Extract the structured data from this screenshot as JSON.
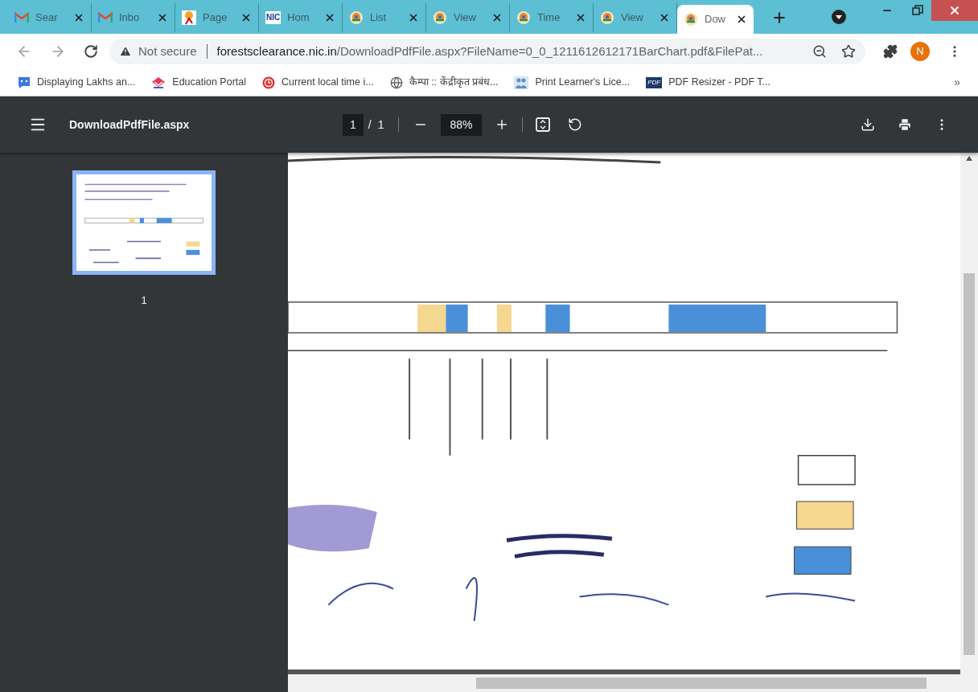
{
  "tabs": [
    {
      "label": "Sear",
      "kind": "gmail",
      "selected": false
    },
    {
      "label": "Inbo",
      "kind": "gmail",
      "selected": false
    },
    {
      "label": "Page",
      "kind": "runner",
      "selected": false
    },
    {
      "label": "Hom",
      "kind": "nic",
      "icon_text": "NIC",
      "selected": false
    },
    {
      "label": "List",
      "kind": "emblem",
      "selected": false
    },
    {
      "label": "View",
      "kind": "emblem",
      "selected": false
    },
    {
      "label": "Time",
      "kind": "emblem",
      "selected": false
    },
    {
      "label": "View",
      "kind": "emblem",
      "selected": false
    },
    {
      "label": "Dow",
      "kind": "emblem",
      "selected": true
    }
  ],
  "address_bar": {
    "security": "Not secure",
    "host": "forestsclearance.nic.in",
    "path": "/DownloadPdfFile.aspx?FileName=0_0_1211612612171BarChart.pdf&FilePat..."
  },
  "profile": {
    "initial": "N"
  },
  "bookmarks": [
    {
      "label": "Displaying Lakhs an...",
      "kind": "chat"
    },
    {
      "label": "Education Portal",
      "kind": "portal"
    },
    {
      "label": "Current local time i...",
      "kind": "clock"
    },
    {
      "label": "कैम्पा :: केंद्रीकृत प्रबंध...",
      "kind": "globe"
    },
    {
      "label": "Print Learner's Lice...",
      "kind": "people"
    },
    {
      "label": "PDF Resizer - PDF T...",
      "kind": "pdf",
      "icon_text": "PDF"
    }
  ],
  "bookmarks_overflow": "»",
  "pdf_toolbar": {
    "title": "DownloadPdfFile.aspx",
    "page_current": "1",
    "page_separator": "/",
    "page_total": "1",
    "zoom": "88%"
  },
  "thumbnails": [
    {
      "label": "1",
      "selected": true
    }
  ]
}
